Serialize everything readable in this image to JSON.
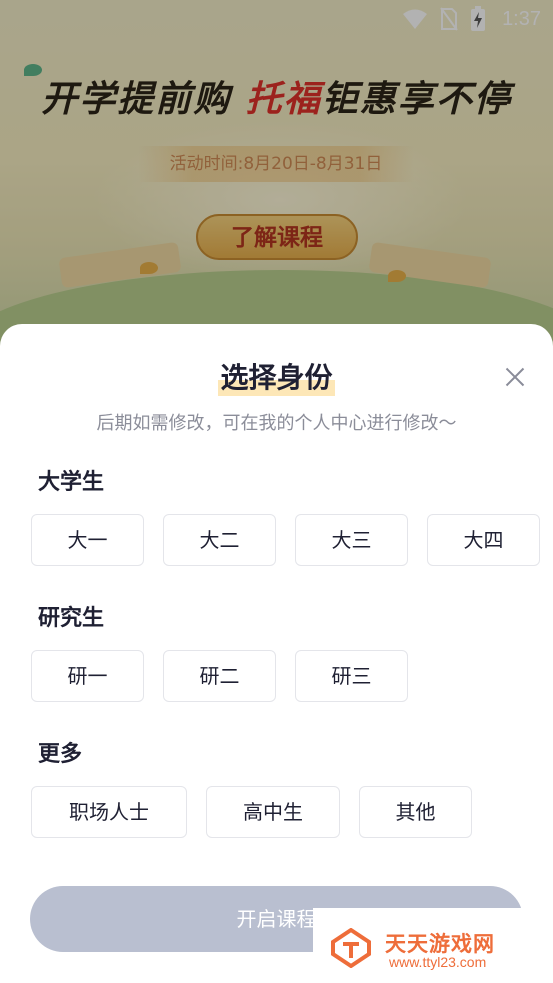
{
  "status_bar": {
    "time": "1:37",
    "icons": [
      "wifi-icon",
      "no-sim-icon",
      "battery-charging-icon"
    ]
  },
  "banner": {
    "headline_part1": "开学提前购",
    "headline_accent": "托福",
    "headline_part2": "钜惠享不停",
    "event_time": "活动时间:8月20日-8月31日",
    "learn_button": "了解课程"
  },
  "sheet": {
    "title": "选择身份",
    "subtitle": "后期如需修改，可在我的个人中心进行修改～",
    "sections": [
      {
        "title": "大学生",
        "options": [
          "大一",
          "大二",
          "大三",
          "大四"
        ]
      },
      {
        "title": "研究生",
        "options": [
          "研一",
          "研二",
          "研三"
        ]
      },
      {
        "title": "更多",
        "options": [
          "职场人士",
          "高中生",
          "其他"
        ]
      }
    ],
    "start_button": "开启课程"
  },
  "watermark": {
    "name": "天天游戏网",
    "url": "www.ttyl23.com"
  },
  "colors": {
    "title_highlight": "#fde7b7",
    "start_button_disabled": "#b9bfd0",
    "watermark_orange": "#ee6d3a"
  }
}
